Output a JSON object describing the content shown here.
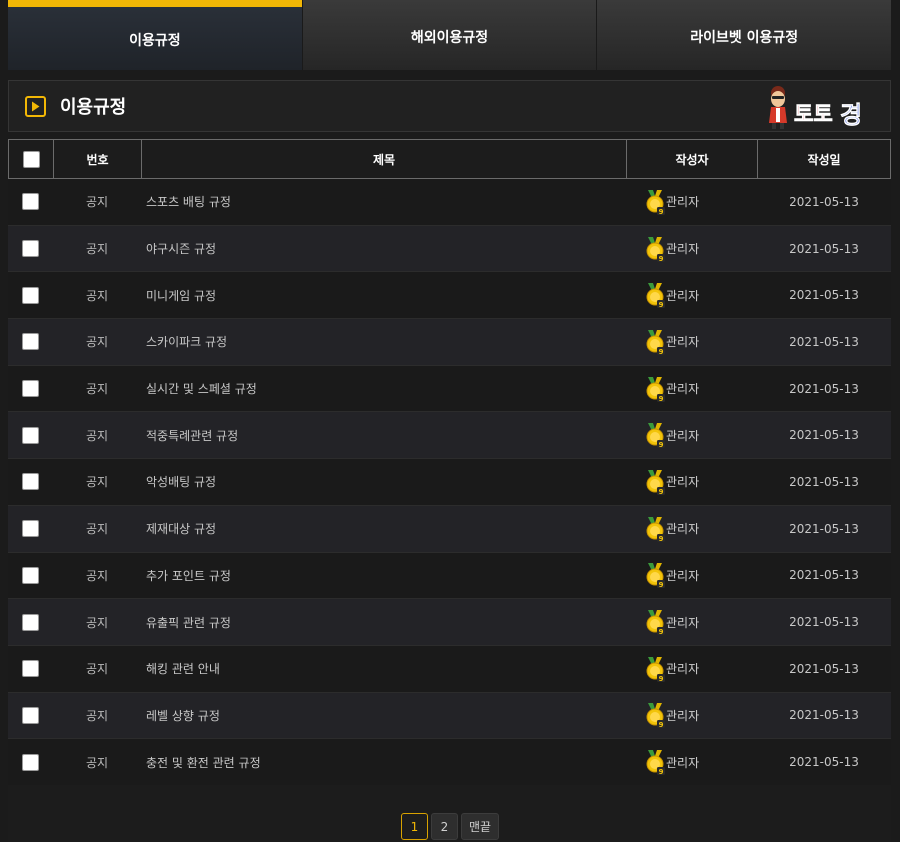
{
  "tabs": [
    {
      "label": "이용규정",
      "active": true
    },
    {
      "label": "해외이용규정",
      "active": false
    },
    {
      "label": "라이브벳 이용규정",
      "active": false
    }
  ],
  "board": {
    "title": "이용규정",
    "logo_text": "토토경",
    "icon": "play-icon"
  },
  "table": {
    "headers": {
      "number": "번호",
      "subject": "제목",
      "writer": "작성자",
      "date": "작성일"
    },
    "rows": [
      {
        "number": "공지",
        "subject": "스포츠 배팅 규정",
        "writer": "관리자",
        "date": "2021-05-13"
      },
      {
        "number": "공지",
        "subject": "야구시즌 규정",
        "writer": "관리자",
        "date": "2021-05-13"
      },
      {
        "number": "공지",
        "subject": "미니게임 규정",
        "writer": "관리자",
        "date": "2021-05-13"
      },
      {
        "number": "공지",
        "subject": "스카이파크 규정",
        "writer": "관리자",
        "date": "2021-05-13"
      },
      {
        "number": "공지",
        "subject": "실시간 및 스페셜 규정",
        "writer": "관리자",
        "date": "2021-05-13"
      },
      {
        "number": "공지",
        "subject": "적중특례관련 규정",
        "writer": "관리자",
        "date": "2021-05-13"
      },
      {
        "number": "공지",
        "subject": "악성배팅 규정",
        "writer": "관리자",
        "date": "2021-05-13"
      },
      {
        "number": "공지",
        "subject": "제재대상 규정",
        "writer": "관리자",
        "date": "2021-05-13"
      },
      {
        "number": "공지",
        "subject": "추가 포인트 규정",
        "writer": "관리자",
        "date": "2021-05-13"
      },
      {
        "number": "공지",
        "subject": "유출픽 관련 규정",
        "writer": "관리자",
        "date": "2021-05-13"
      },
      {
        "number": "공지",
        "subject": "해킹 관련 안내",
        "writer": "관리자",
        "date": "2021-05-13"
      },
      {
        "number": "공지",
        "subject": "레벨 상향 규정",
        "writer": "관리자",
        "date": "2021-05-13"
      },
      {
        "number": "공지",
        "subject": "충전 및 환전 관련 규정",
        "writer": "관리자",
        "date": "2021-05-13"
      }
    ]
  },
  "pagination": {
    "pages": [
      "1",
      "2"
    ],
    "current": "1",
    "last_label": "맨끝"
  },
  "colors": {
    "accent": "#f2b705",
    "background": "#1b1b1b",
    "row_alt": "#232327"
  }
}
